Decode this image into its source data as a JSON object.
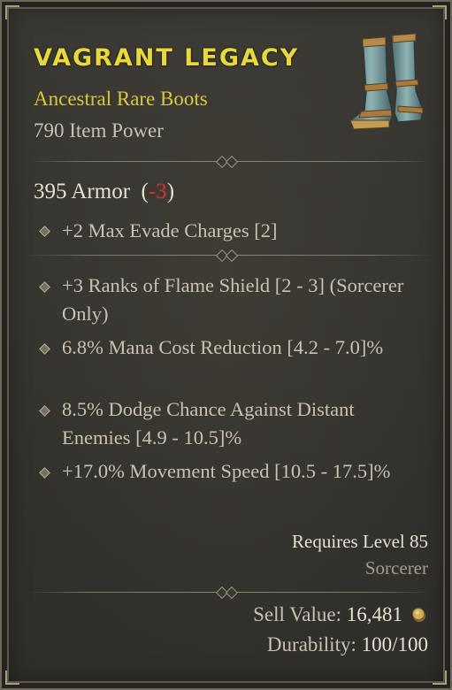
{
  "item": {
    "name": "VAGRANT LEGACY",
    "type": "Ancestral Rare Boots",
    "item_power": "790 Item Power",
    "image": "boots-icon"
  },
  "armor": {
    "text": "395 Armor  (",
    "change": "-3",
    "close": ")"
  },
  "implicit": [
    {
      "text": "+2 Max Evade Charges [2]"
    }
  ],
  "affixes": [
    {
      "text": "+3 Ranks of Flame Shield [2 - 3] (Sorcerer Only)"
    },
    {
      "text": "6.8% Mana Cost Reduction [4.2 - 7.0]%"
    },
    {
      "text": "8.5% Dodge Chance Against Distant Enemies [4.9 - 10.5]%"
    },
    {
      "text": "+17.0% Movement Speed [10.5 - 17.5]%"
    }
  ],
  "requirements": {
    "level": "Requires Level 85",
    "class": "Sorcerer"
  },
  "footer": {
    "sell_label": "Sell Value: ",
    "sell_value": "16,481",
    "currency_icon": "gold-coin-icon",
    "durability_label": "Durability: ",
    "durability_value": "100/100"
  },
  "colors": {
    "title": "#e6d83e",
    "rare": "#d8c83e",
    "negative": "#d9322a"
  }
}
